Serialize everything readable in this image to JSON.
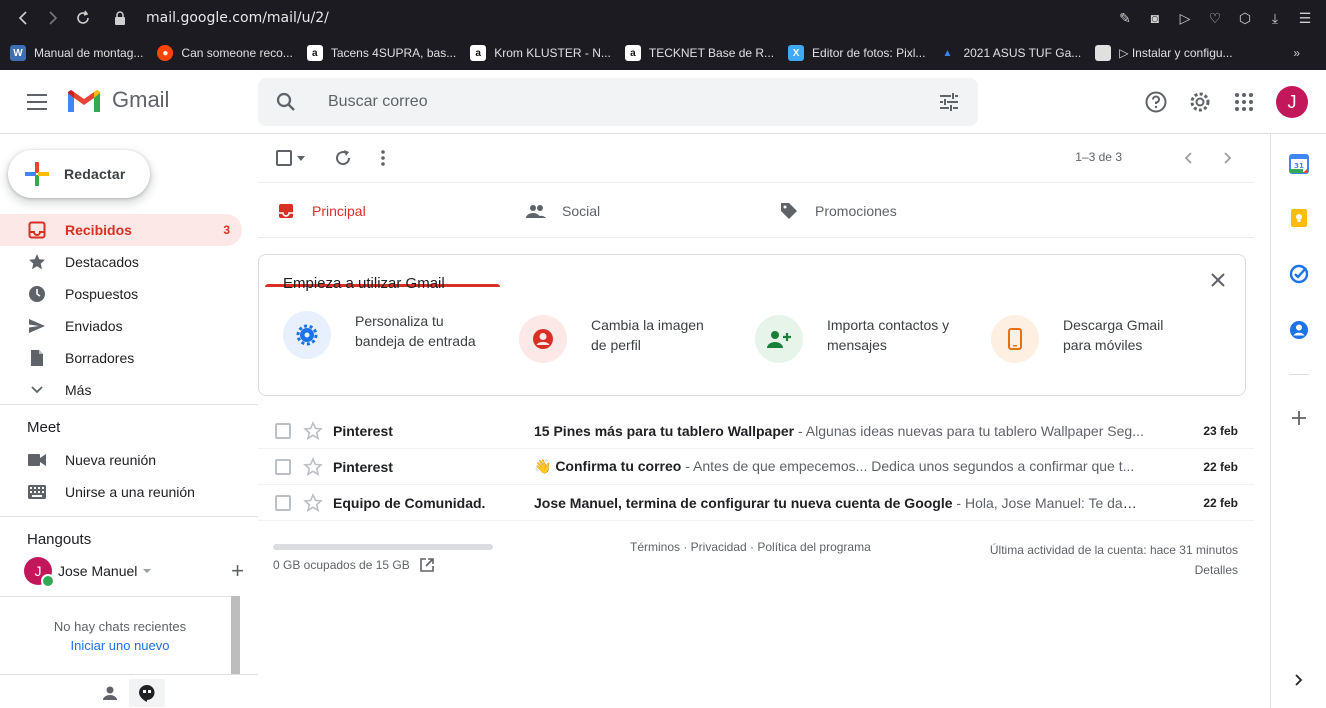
{
  "browser": {
    "url": "mail.google.com/mail/u/2/",
    "bookmarks": [
      {
        "label": "Manual de montag...",
        "icon": "wordpress-icon",
        "color": "#3d6fb5"
      },
      {
        "label": "Can someone reco...",
        "icon": "reddit-icon",
        "color": "#ff4500"
      },
      {
        "label": "Tacens 4SUPRA, bas...",
        "icon": "amazon-icon",
        "color": "#ffffff"
      },
      {
        "label": "Krom KLUSTER - N...",
        "icon": "amazon-icon",
        "color": "#ffffff"
      },
      {
        "label": "TECKNET Base de R...",
        "icon": "amazon-icon",
        "color": "#ffffff"
      },
      {
        "label": "Editor de fotos: Pixl...",
        "icon": "pixlr-icon",
        "color": "#3fa9f5"
      },
      {
        "label": "2021 ASUS TUF Ga...",
        "icon": "asus-icon",
        "color": "#3b82f6"
      },
      {
        "label": "▷ Instalar y configu...",
        "icon": "page-icon",
        "color": "#e0e0e0"
      }
    ]
  },
  "header": {
    "app_name": "Gmail",
    "search_placeholder": "Buscar correo",
    "avatar_letter": "J"
  },
  "sidebar": {
    "compose_label": "Redactar",
    "items": [
      {
        "label": "Recibidos",
        "count": "3",
        "icon": "inbox-icon",
        "active": true
      },
      {
        "label": "Destacados",
        "count": "",
        "icon": "star-icon",
        "active": false
      },
      {
        "label": "Pospuestos",
        "count": "",
        "icon": "clock-icon",
        "active": false
      },
      {
        "label": "Enviados",
        "count": "",
        "icon": "send-icon",
        "active": false
      },
      {
        "label": "Borradores",
        "count": "",
        "icon": "draft-icon",
        "active": false
      },
      {
        "label": "Más",
        "count": "",
        "icon": "chevron-down-icon",
        "active": false
      }
    ],
    "meet": {
      "title": "Meet",
      "new_meeting": "Nueva reunión",
      "join_meeting": "Unirse a una reunión"
    },
    "hangouts": {
      "title": "Hangouts",
      "user_letter": "J",
      "user_name": "Jose Manuel",
      "no_chats": "No hay chats recientes",
      "start_new": "Iniciar uno nuevo"
    }
  },
  "toolbar": {
    "pager": "1–3 de 3"
  },
  "tabs": [
    {
      "label": "Principal",
      "icon": "inbox-icon"
    },
    {
      "label": "Social",
      "icon": "people-icon"
    },
    {
      "label": "Promociones",
      "icon": "tag-icon"
    }
  ],
  "promo": {
    "title": "Empieza a utilizar Gmail",
    "items": [
      {
        "text": "Personaliza tu bandeja de entrada",
        "icon": "gear-icon",
        "bg": "#e8f0fe",
        "fg": "#1a73e8"
      },
      {
        "text": "Cambia la imagen de perfil",
        "icon": "account-icon",
        "bg": "#fce8e6",
        "fg": "#d93025"
      },
      {
        "text": "Importa contactos y mensajes",
        "icon": "person-add-icon",
        "bg": "#e6f4ea",
        "fg": "#188038"
      },
      {
        "text": "Descarga Gmail para móviles",
        "icon": "phone-icon",
        "bg": "#feefe3",
        "fg": "#e8710a"
      }
    ]
  },
  "emails": [
    {
      "sender": "Pinterest",
      "subject": "15 Pines más para tu tablero Wallpaper",
      "snippet": " - Algunas ideas nuevas para tu tablero Wallpaper Seg...",
      "date": "23 feb"
    },
    {
      "sender": "Pinterest",
      "subject": "👋 Confirma tu correo",
      "snippet": " - Antes de que empecemos... Dedica unos segundos a confirmar que t...",
      "date": "22 feb"
    },
    {
      "sender": "Equipo de Comunidad.",
      "subject": "Jose Manuel, termina de configurar tu nueva cuenta de Google",
      "snippet": " - Hola, Jose Manuel: Te damo...",
      "date": "22 feb"
    }
  ],
  "footer": {
    "storage": "0 GB ocupados de 15 GB",
    "links": "Términos · Privacidad · Política del programa",
    "activity": "Última actividad de la cuenta: hace 31 minutos",
    "details": "Detalles"
  },
  "colors": {
    "accent_red": "#d93025",
    "link_blue": "#1a73e8",
    "avatar": "#c2185b"
  }
}
